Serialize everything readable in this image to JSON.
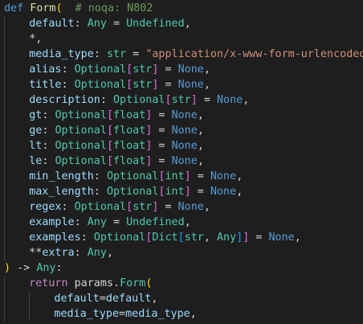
{
  "colors": {
    "background": "#1e1e1e",
    "keyword": "#569cd6",
    "control_keyword": "#c586c0",
    "function": "#dcdcaa",
    "parameter": "#9cdcfe",
    "type": "#4ec9b0",
    "string": "#ce9178",
    "comment": "#6a9955",
    "plain": "#d4d4d4",
    "bracket_level1": "#ffd700",
    "bracket_level2": "#da70d6",
    "bracket_level3": "#179fff"
  },
  "code": {
    "lines": [
      {
        "indent": 0,
        "tokens": [
          {
            "t": "def",
            "k": "keyword"
          },
          {
            "t": " ",
            "k": "plain"
          },
          {
            "t": "Form",
            "k": "function"
          },
          {
            "t": "(",
            "k": "bracket1"
          },
          {
            "t": "  # noqa: N802",
            "k": "comment"
          }
        ]
      },
      {
        "indent": 1,
        "tokens": [
          {
            "t": "default",
            "k": "param"
          },
          {
            "t": ": ",
            "k": "plain"
          },
          {
            "t": "Any",
            "k": "type"
          },
          {
            "t": " = ",
            "k": "plain"
          },
          {
            "t": "Undefined",
            "k": "type"
          },
          {
            "t": ",",
            "k": "plain"
          }
        ]
      },
      {
        "indent": 1,
        "tokens": [
          {
            "t": "*,",
            "k": "plain"
          }
        ]
      },
      {
        "indent": 1,
        "tokens": [
          {
            "t": "media_type",
            "k": "param"
          },
          {
            "t": ": ",
            "k": "plain"
          },
          {
            "t": "str",
            "k": "type"
          },
          {
            "t": " = ",
            "k": "plain"
          },
          {
            "t": "\"application/x-www-form-urlencoded\"",
            "k": "string"
          },
          {
            "t": ",",
            "k": "plain"
          }
        ]
      },
      {
        "indent": 1,
        "tokens": [
          {
            "t": "alias",
            "k": "param"
          },
          {
            "t": ": ",
            "k": "plain"
          },
          {
            "t": "Optional",
            "k": "type"
          },
          {
            "t": "[",
            "k": "bracket2"
          },
          {
            "t": "str",
            "k": "type"
          },
          {
            "t": "]",
            "k": "bracket2"
          },
          {
            "t": " = ",
            "k": "plain"
          },
          {
            "t": "None",
            "k": "const"
          },
          {
            "t": ",",
            "k": "plain"
          }
        ]
      },
      {
        "indent": 1,
        "tokens": [
          {
            "t": "title",
            "k": "param"
          },
          {
            "t": ": ",
            "k": "plain"
          },
          {
            "t": "Optional",
            "k": "type"
          },
          {
            "t": "[",
            "k": "bracket2"
          },
          {
            "t": "str",
            "k": "type"
          },
          {
            "t": "]",
            "k": "bracket2"
          },
          {
            "t": " = ",
            "k": "plain"
          },
          {
            "t": "None",
            "k": "const"
          },
          {
            "t": ",",
            "k": "plain"
          }
        ]
      },
      {
        "indent": 1,
        "tokens": [
          {
            "t": "description",
            "k": "param"
          },
          {
            "t": ": ",
            "k": "plain"
          },
          {
            "t": "Optional",
            "k": "type"
          },
          {
            "t": "[",
            "k": "bracket2"
          },
          {
            "t": "str",
            "k": "type"
          },
          {
            "t": "]",
            "k": "bracket2"
          },
          {
            "t": " = ",
            "k": "plain"
          },
          {
            "t": "None",
            "k": "const"
          },
          {
            "t": ",",
            "k": "plain"
          }
        ]
      },
      {
        "indent": 1,
        "tokens": [
          {
            "t": "gt",
            "k": "param"
          },
          {
            "t": ": ",
            "k": "plain"
          },
          {
            "t": "Optional",
            "k": "type"
          },
          {
            "t": "[",
            "k": "bracket2"
          },
          {
            "t": "float",
            "k": "type"
          },
          {
            "t": "]",
            "k": "bracket2"
          },
          {
            "t": " = ",
            "k": "plain"
          },
          {
            "t": "None",
            "k": "const"
          },
          {
            "t": ",",
            "k": "plain"
          }
        ]
      },
      {
        "indent": 1,
        "tokens": [
          {
            "t": "ge",
            "k": "param"
          },
          {
            "t": ": ",
            "k": "plain"
          },
          {
            "t": "Optional",
            "k": "type"
          },
          {
            "t": "[",
            "k": "bracket2"
          },
          {
            "t": "float",
            "k": "type"
          },
          {
            "t": "]",
            "k": "bracket2"
          },
          {
            "t": " = ",
            "k": "plain"
          },
          {
            "t": "None",
            "k": "const"
          },
          {
            "t": ",",
            "k": "plain"
          }
        ]
      },
      {
        "indent": 1,
        "tokens": [
          {
            "t": "lt",
            "k": "param"
          },
          {
            "t": ": ",
            "k": "plain"
          },
          {
            "t": "Optional",
            "k": "type"
          },
          {
            "t": "[",
            "k": "bracket2"
          },
          {
            "t": "float",
            "k": "type"
          },
          {
            "t": "]",
            "k": "bracket2"
          },
          {
            "t": " = ",
            "k": "plain"
          },
          {
            "t": "None",
            "k": "const"
          },
          {
            "t": ",",
            "k": "plain"
          }
        ]
      },
      {
        "indent": 1,
        "tokens": [
          {
            "t": "le",
            "k": "param"
          },
          {
            "t": ": ",
            "k": "plain"
          },
          {
            "t": "Optional",
            "k": "type"
          },
          {
            "t": "[",
            "k": "bracket2"
          },
          {
            "t": "float",
            "k": "type"
          },
          {
            "t": "]",
            "k": "bracket2"
          },
          {
            "t": " = ",
            "k": "plain"
          },
          {
            "t": "None",
            "k": "const"
          },
          {
            "t": ",",
            "k": "plain"
          }
        ]
      },
      {
        "indent": 1,
        "tokens": [
          {
            "t": "min_length",
            "k": "param"
          },
          {
            "t": ": ",
            "k": "plain"
          },
          {
            "t": "Optional",
            "k": "type"
          },
          {
            "t": "[",
            "k": "bracket2"
          },
          {
            "t": "int",
            "k": "type"
          },
          {
            "t": "]",
            "k": "bracket2"
          },
          {
            "t": " = ",
            "k": "plain"
          },
          {
            "t": "None",
            "k": "const"
          },
          {
            "t": ",",
            "k": "plain"
          }
        ]
      },
      {
        "indent": 1,
        "tokens": [
          {
            "t": "max_length",
            "k": "param"
          },
          {
            "t": ": ",
            "k": "plain"
          },
          {
            "t": "Optional",
            "k": "type"
          },
          {
            "t": "[",
            "k": "bracket2"
          },
          {
            "t": "int",
            "k": "type"
          },
          {
            "t": "]",
            "k": "bracket2"
          },
          {
            "t": " = ",
            "k": "plain"
          },
          {
            "t": "None",
            "k": "const"
          },
          {
            "t": ",",
            "k": "plain"
          }
        ]
      },
      {
        "indent": 1,
        "tokens": [
          {
            "t": "regex",
            "k": "param"
          },
          {
            "t": ": ",
            "k": "plain"
          },
          {
            "t": "Optional",
            "k": "type"
          },
          {
            "t": "[",
            "k": "bracket2"
          },
          {
            "t": "str",
            "k": "type"
          },
          {
            "t": "]",
            "k": "bracket2"
          },
          {
            "t": " = ",
            "k": "plain"
          },
          {
            "t": "None",
            "k": "const"
          },
          {
            "t": ",",
            "k": "plain"
          }
        ]
      },
      {
        "indent": 1,
        "tokens": [
          {
            "t": "example",
            "k": "param"
          },
          {
            "t": ": ",
            "k": "plain"
          },
          {
            "t": "Any",
            "k": "type"
          },
          {
            "t": " = ",
            "k": "plain"
          },
          {
            "t": "Undefined",
            "k": "type"
          },
          {
            "t": ",",
            "k": "plain"
          }
        ]
      },
      {
        "indent": 1,
        "tokens": [
          {
            "t": "examples",
            "k": "param"
          },
          {
            "t": ": ",
            "k": "plain"
          },
          {
            "t": "Optional",
            "k": "type"
          },
          {
            "t": "[",
            "k": "bracket2"
          },
          {
            "t": "Dict",
            "k": "type"
          },
          {
            "t": "[",
            "k": "bracket3"
          },
          {
            "t": "str",
            "k": "type"
          },
          {
            "t": ", ",
            "k": "plain"
          },
          {
            "t": "Any",
            "k": "type"
          },
          {
            "t": "]",
            "k": "bracket3"
          },
          {
            "t": "]",
            "k": "bracket2"
          },
          {
            "t": " = ",
            "k": "plain"
          },
          {
            "t": "None",
            "k": "const"
          },
          {
            "t": ",",
            "k": "plain"
          }
        ]
      },
      {
        "indent": 1,
        "tokens": [
          {
            "t": "**",
            "k": "plain"
          },
          {
            "t": "extra",
            "k": "param"
          },
          {
            "t": ": ",
            "k": "plain"
          },
          {
            "t": "Any",
            "k": "type"
          },
          {
            "t": ",",
            "k": "plain"
          }
        ]
      },
      {
        "indent": 0,
        "tokens": [
          {
            "t": ")",
            "k": "bracket1"
          },
          {
            "t": " -> ",
            "k": "plain"
          },
          {
            "t": "Any",
            "k": "type"
          },
          {
            "t": ":",
            "k": "plain"
          }
        ]
      },
      {
        "indent": 1,
        "tokens": [
          {
            "t": "return",
            "k": "control"
          },
          {
            "t": " ",
            "k": "plain"
          },
          {
            "t": "params",
            "k": "plain"
          },
          {
            "t": ".",
            "k": "plain"
          },
          {
            "t": "Form",
            "k": "type"
          },
          {
            "t": "(",
            "k": "bracket1"
          }
        ]
      },
      {
        "indent": 2,
        "tokens": [
          {
            "t": "default",
            "k": "param"
          },
          {
            "t": "=",
            "k": "plain"
          },
          {
            "t": "default",
            "k": "param"
          },
          {
            "t": ",",
            "k": "plain"
          }
        ]
      },
      {
        "indent": 2,
        "tokens": [
          {
            "t": "media_type",
            "k": "param"
          },
          {
            "t": "=",
            "k": "plain"
          },
          {
            "t": "media_type",
            "k": "param"
          },
          {
            "t": ",",
            "k": "plain"
          }
        ]
      }
    ]
  }
}
